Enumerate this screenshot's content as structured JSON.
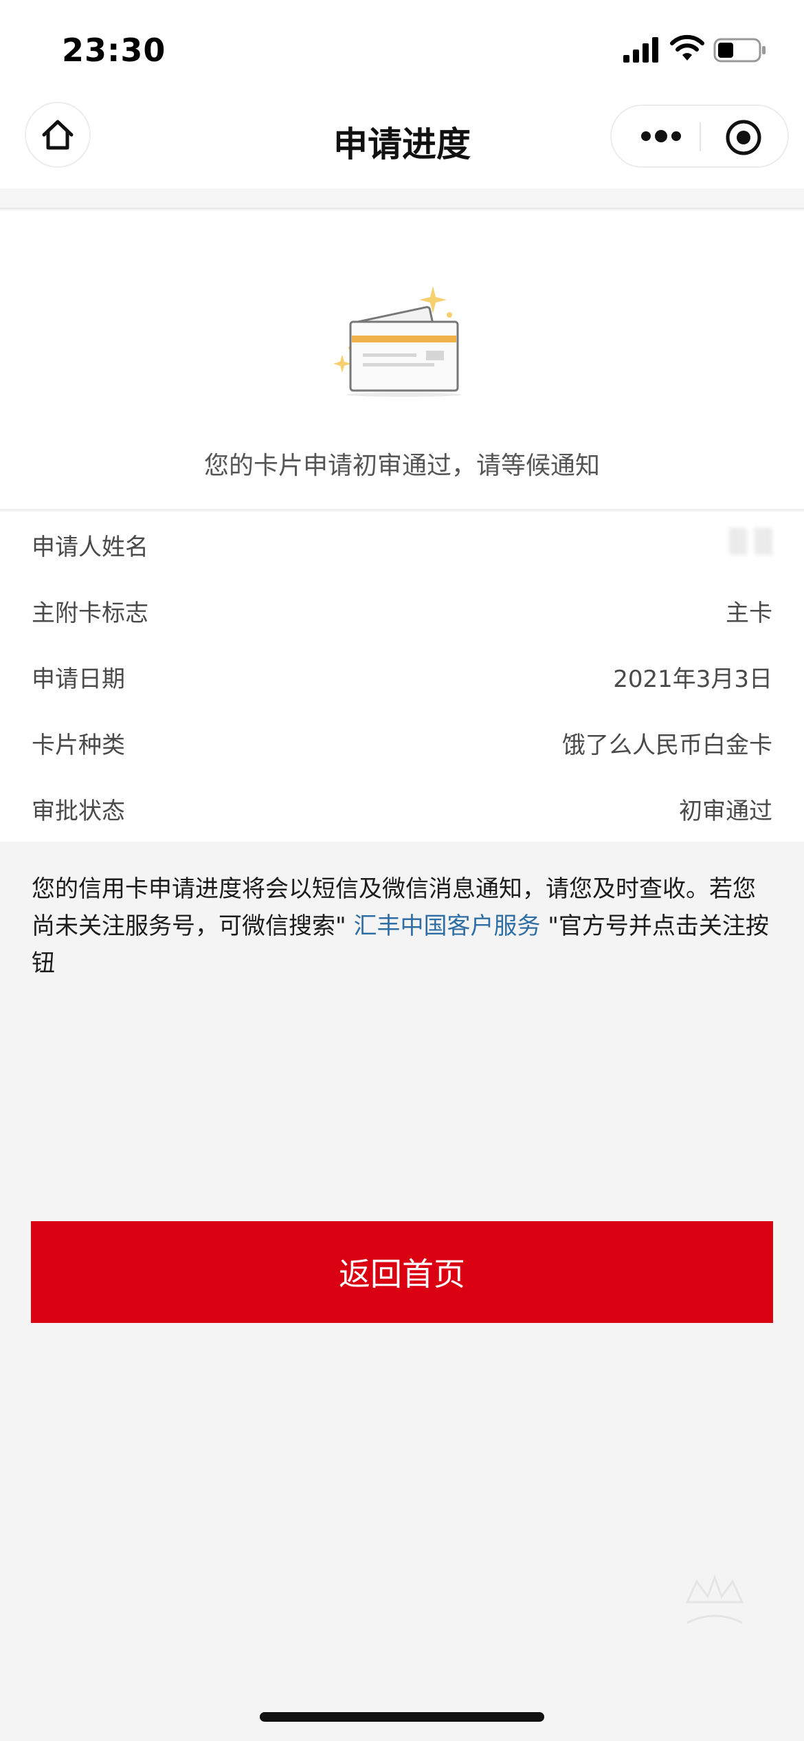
{
  "status_bar": {
    "time": "23:30",
    "icons": [
      "signal-icon",
      "wifi-icon",
      "battery-icon"
    ]
  },
  "nav": {
    "title": "申请进度",
    "home_icon": "home-icon",
    "more_icon": "more-dots-icon",
    "close_icon": "target-close-icon"
  },
  "hero": {
    "illustration": "credit-card-illustration",
    "message": "您的卡片申请初审通过，请等候通知"
  },
  "info": {
    "rows": [
      {
        "label": "申请人姓名",
        "value": "▒ ▒"
      },
      {
        "label": "主附卡标志",
        "value": "主卡"
      },
      {
        "label": "申请日期",
        "value": "2021年3月3日"
      },
      {
        "label": "卡片种类",
        "value": "饿了么人民币白金卡"
      },
      {
        "label": "审批状态",
        "value": "初审通过"
      }
    ]
  },
  "notice": {
    "text_before": "您的信用卡申请进度将会以短信及微信消息通知，请您及时查收。若您尚未关注服务号，可微信搜索\" ",
    "link": "汇丰中国客户服务",
    "text_after": " \"官方号并点击关注按钮"
  },
  "actions": {
    "back_home_label": "返回首页"
  },
  "colors": {
    "accent_red": "#db0011",
    "link_blue": "#2f6ea5",
    "card_stripe": "#f0b04a"
  }
}
